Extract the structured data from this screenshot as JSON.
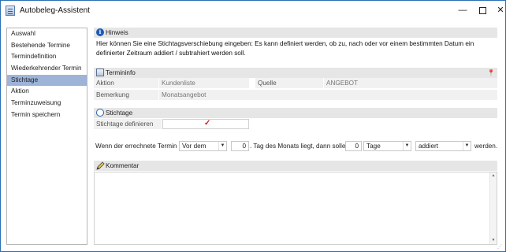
{
  "window": {
    "title": "Autobeleg-Assistent",
    "minimize": "—",
    "close": "✕"
  },
  "nav": {
    "items": [
      {
        "label": "Auswahl",
        "active": false
      },
      {
        "label": "Bestehende Termine",
        "active": false
      },
      {
        "label": "Termindefinition",
        "active": false
      },
      {
        "label": "Wiederkehrender Termin",
        "active": false
      },
      {
        "label": "Stichtage",
        "active": true
      },
      {
        "label": "Aktion",
        "active": false
      },
      {
        "label": "Terminzuweisung",
        "active": false
      },
      {
        "label": "Termin speichern",
        "active": false
      }
    ]
  },
  "hinweis": {
    "title": "Hinweis",
    "text": "Hier können Sie eine Stichtagsverschiebung eingeben: Es kann definiert werden, ob zu, nach oder vor einem bestimmten Datum ein definierter Zeitraum addiert / subtrahiert werden soll."
  },
  "termininfo": {
    "title": "Termininfo",
    "aktion_label": "Aktion",
    "aktion_value": "Kundenliste",
    "quelle_label": "Quelle",
    "quelle_value": "ANGEBOT",
    "bemerkung_label": "Bemerkung",
    "bemerkung_value": "Monatsangebot"
  },
  "stichtage": {
    "title": "Stichtage",
    "define_label": "Stichtage definieren",
    "define_checked": true,
    "check_glyph": "✓"
  },
  "rule": {
    "prefix": "Wenn der errechnete Termin",
    "position_value": "Vor dem",
    "day_value": "0",
    "middle": ". Tag des Monats liegt, dann sollen",
    "count_value": "0",
    "unit_value": "Tage",
    "operation_value": "addiert",
    "suffix": "werden."
  },
  "kommentar": {
    "title": "Kommentar",
    "value": ""
  },
  "colors": {
    "accent": "#9db4d8",
    "section_bg": "#e6e6e6",
    "check": "#d11f26",
    "border": "#2b6fb5"
  },
  "icons": {
    "app": "document-icon",
    "hinweis": "info-icon",
    "termininfo": "window-icon",
    "stichtage": "clock-icon",
    "kommentar": "pencil-icon",
    "pin": "pin-icon",
    "dropdown": "chevron-down-icon"
  }
}
